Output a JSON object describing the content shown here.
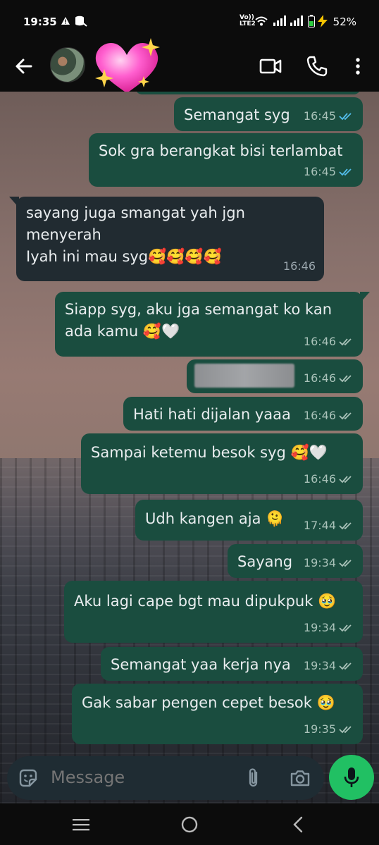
{
  "status_bar": {
    "time": "19:35",
    "network_label": "Vo))\nLTE2",
    "battery_pct": "52%"
  },
  "header": {
    "contact_avatar": "avatar",
    "name_sticker": "sparkling-heart-emoji",
    "icons": [
      "back-arrow-icon",
      "video-call-icon",
      "voice-call-icon",
      "more-vert-icon"
    ]
  },
  "messages": [
    {
      "dir": "out",
      "text": "Semangat syg",
      "time": "16:45",
      "status": "read"
    },
    {
      "dir": "out",
      "text": "Sok gra berangkat bisi terlambat",
      "time": "16:45",
      "status": "read"
    },
    {
      "dir": "in",
      "text_line1": "sayang juga smangat yah jgn",
      "text_line2": "menyerah",
      "text_line3": "Iyah ini mau syg🥰🥰🥰🥰",
      "time": "16:46"
    },
    {
      "dir": "out",
      "text_line1": "Siapp syg, aku jga semangat ko kan",
      "text_line2": "ada kamu 🥰🤍",
      "time": "16:46",
      "status": "delivered"
    },
    {
      "dir": "out",
      "text": "",
      "time": "16:46",
      "status": "delivered"
    },
    {
      "dir": "out",
      "text": "Hati hati dijalan yaaa",
      "time": "16:46",
      "status": "delivered"
    },
    {
      "dir": "out",
      "text": "Sampai ketemu besok syg 🥰🤍",
      "time": "16:46",
      "status": "delivered"
    },
    {
      "dir": "out",
      "text": "Udh kangen aja 🫠",
      "time": "17:44",
      "status": "delivered"
    },
    {
      "dir": "out",
      "text": "Sayang",
      "time": "19:34",
      "status": "delivered"
    },
    {
      "dir": "out",
      "text": "Aku lagi cape bgt mau dipukpuk 🥹",
      "time": "19:34",
      "status": "delivered"
    },
    {
      "dir": "out",
      "text": "Semangat yaa kerja nya",
      "time": "19:34",
      "status": "delivered"
    },
    {
      "dir": "out",
      "text": "Gak sabar pengen cepet besok 🥹",
      "time": "19:35",
      "status": "delivered"
    }
  ],
  "composer": {
    "placeholder": "Message"
  },
  "colors": {
    "outgoing_bubble": "#1a4d3f",
    "incoming_bubble": "#212b31",
    "read_tick": "#53bdeb",
    "delivered_tick": "#a9c2b9",
    "accent": "#21c063"
  }
}
